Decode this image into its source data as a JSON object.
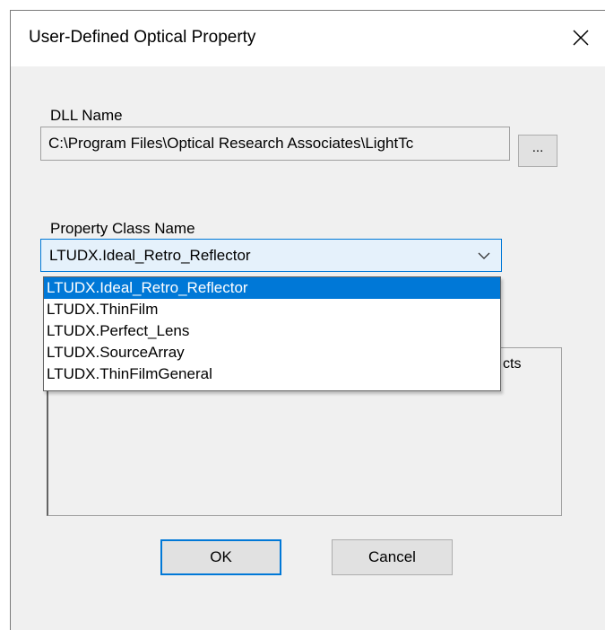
{
  "dialog": {
    "title": "User-Defined Optical Property",
    "close_glyph": "✕"
  },
  "dll": {
    "label": "DLL Name",
    "value": "C:\\Program Files\\Optical Research Associates\\LightTc",
    "browse_label": "..."
  },
  "property_class": {
    "label": "Property Class Name",
    "selected": "LTUDX.Ideal_Retro_Reflector",
    "options": [
      "LTUDX.Ideal_Retro_Reflector",
      "LTUDX.ThinFilm",
      "LTUDX.Perfect_Lens",
      "LTUDX.SourceArray",
      "LTUDX.ThinFilmGeneral"
    ],
    "highlighted_index": 0
  },
  "description": {
    "visible_text": "cts"
  },
  "buttons": {
    "ok_label": "OK",
    "cancel_label": "Cancel"
  },
  "colors": {
    "accent": "#0078d7",
    "dialog_bg": "#f0f0f0",
    "combo_bg": "#e5f1fb",
    "selection_text": "#ffffff"
  },
  "icons": {
    "close": "close-icon",
    "dropdown": "chevron-down-icon"
  }
}
